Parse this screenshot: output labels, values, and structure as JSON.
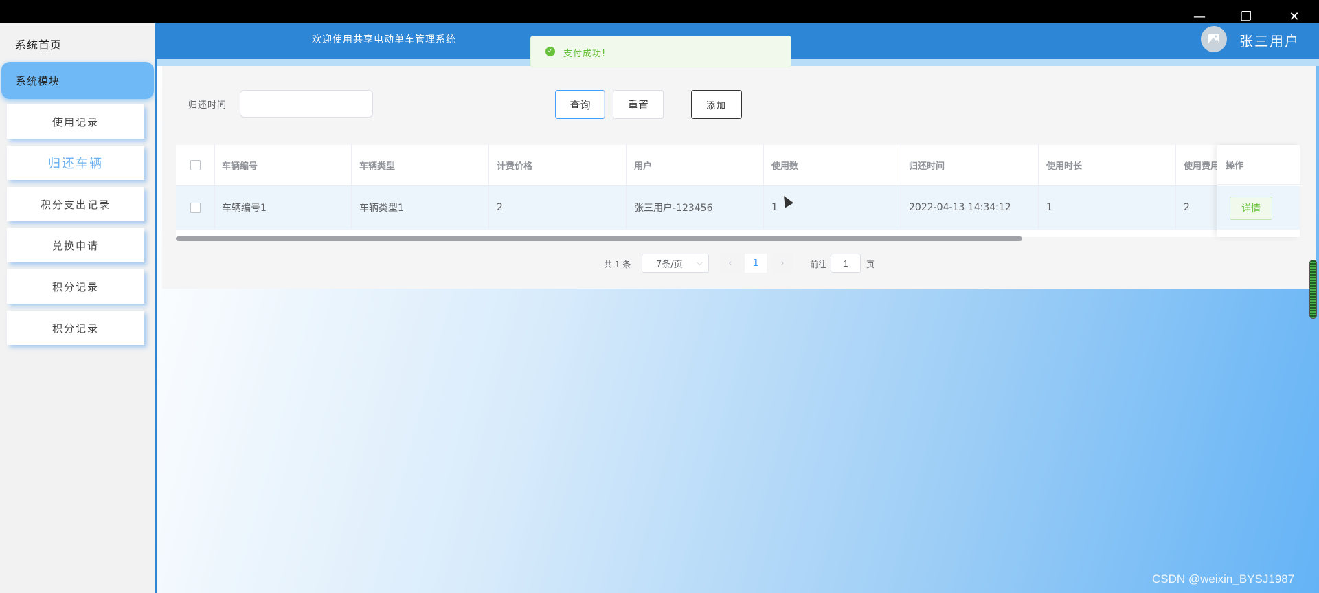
{
  "window": {
    "minimize_glyph": "—",
    "restore_glyph": "❐",
    "close_glyph": "✕"
  },
  "sidebar": {
    "home_label": "系统首页",
    "module_label": "系统模块",
    "items": [
      {
        "label": "使用记录"
      },
      {
        "label": "归还车辆"
      },
      {
        "label": "积分支出记录"
      },
      {
        "label": "兑换申请"
      },
      {
        "label": "积分记录"
      },
      {
        "label": "积分记录"
      }
    ],
    "active_index": 1
  },
  "header": {
    "welcome": "欢迎使用共享电动单车管理系统",
    "username": "张三用户",
    "avatar_icon": "image-icon"
  },
  "toast": {
    "icon": "check-circle-icon",
    "message": "支付成功!"
  },
  "search": {
    "time_label": "归还时间",
    "time_value": "",
    "query_label": "查询",
    "reset_label": "重置",
    "add_label": "添加"
  },
  "table": {
    "columns": [
      "车辆编号",
      "车辆类型",
      "计费价格",
      "用户",
      "使用数",
      "归还时间",
      "使用时长",
      "使用费用",
      "操作"
    ],
    "rows": [
      {
        "vehicle_no": "车辆编号1",
        "vehicle_type": "车辆类型1",
        "price": "2",
        "user": "张三用户-123456",
        "use_count": "1",
        "return_time": "2022-04-13 14:34:12",
        "duration": "1",
        "fee": "2",
        "detail_label": "详情"
      }
    ]
  },
  "pagination": {
    "total_text": "共 1 条",
    "page_size": "7条/页",
    "current_page": "1",
    "goto_prefix": "前往",
    "goto_value": "1",
    "goto_suffix": "页"
  },
  "watermark": "CSDN @weixin_BYSJ1987",
  "colors": {
    "header": "#2e86d6",
    "accent": "#409eff",
    "success": "#67c23a",
    "sidebar_active": "#6fbaf6"
  }
}
